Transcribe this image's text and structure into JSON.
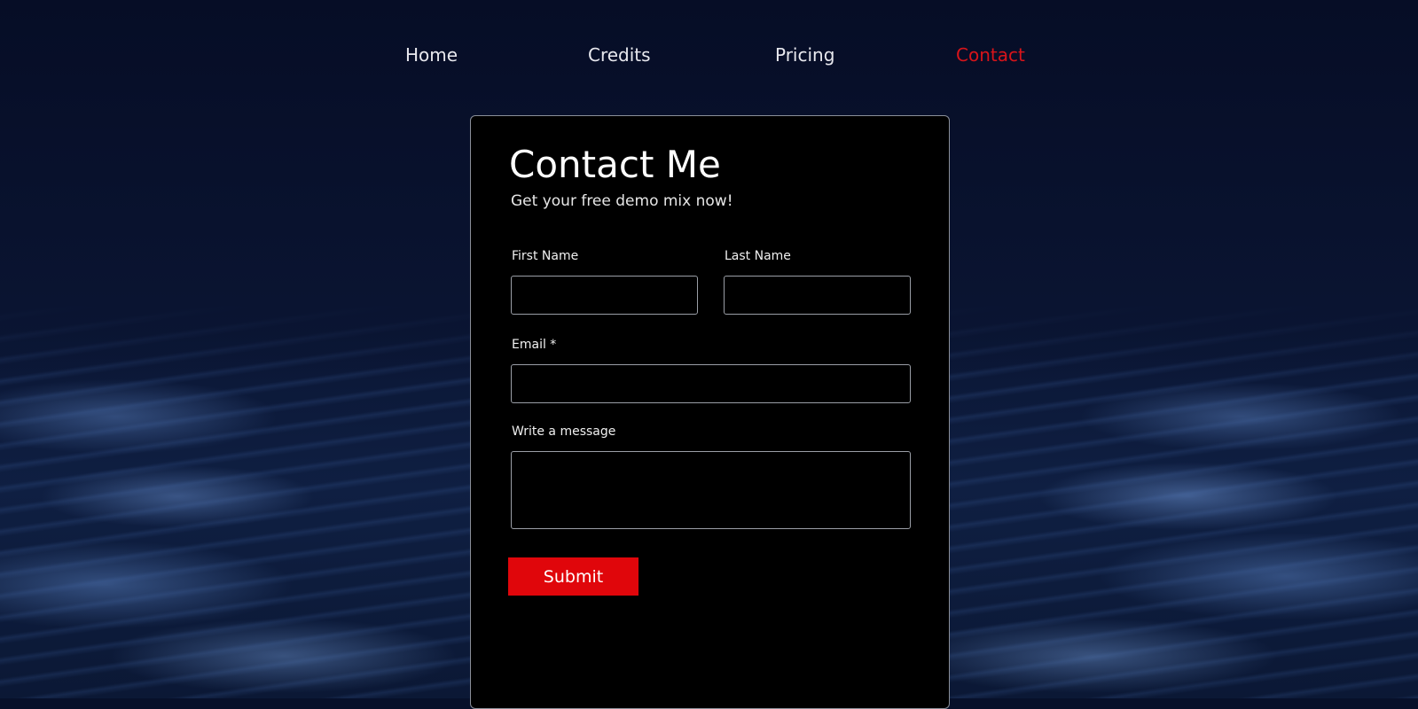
{
  "nav": {
    "items": [
      {
        "label": "Home"
      },
      {
        "label": "Credits"
      },
      {
        "label": "Pricing"
      },
      {
        "label": "Contact"
      }
    ],
    "active_color": "#d8141a"
  },
  "form": {
    "title": "Contact Me",
    "subtitle": "Get your free demo mix now!",
    "first_name": {
      "label": "First Name",
      "value": ""
    },
    "last_name": {
      "label": "Last Name",
      "value": ""
    },
    "email": {
      "label": "Email *",
      "value": ""
    },
    "message": {
      "label": "Write a message",
      "value": ""
    },
    "submit_label": "Submit",
    "submit_color": "#e0060b"
  }
}
